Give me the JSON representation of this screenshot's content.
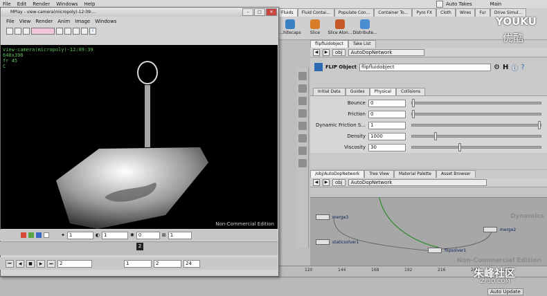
{
  "menubar": [
    "File",
    "Edit",
    "Render",
    "Windows",
    "Help"
  ],
  "topright": {
    "checkbox_label": "Auto Takes",
    "desktop": "Main"
  },
  "shelf": {
    "tabs": [
      "Fluids",
      "Fluid Contai...",
      "Populate Con...",
      "Container To...",
      "Pyro FX",
      "Cloth",
      "Wires",
      "Fur",
      "Drive Simul..."
    ],
    "tools": [
      "...hitecaps",
      "Slice",
      "Slice Alon...",
      "Distribute..."
    ]
  },
  "mplay": {
    "title": "MPlay - view-camera(micropoly)-12:09:...",
    "menu": [
      "File",
      "View",
      "Render",
      "Anim",
      "Image",
      "Windows"
    ],
    "overlay": [
      "view-camera(micropoly)-12:09:39",
      "640x398",
      "fr 45",
      "C"
    ],
    "watermark": "Non-Commercial Edition",
    "ctrl": {
      "f1": "1",
      "f2": "1",
      "f3": "0",
      "f4": "1"
    },
    "frame_marker": "2",
    "play": {
      "frame": "2",
      "start": "1",
      "cur": "2",
      "end": "24"
    }
  },
  "param_panel": {
    "tabs": [
      "flipfluidobject",
      "Take List"
    ],
    "path": [
      "obj",
      "AutoDopNetwork"
    ],
    "type_label": "FLIP Object",
    "name": "flipfluidobject",
    "subtabs": [
      "Initial Data",
      "Guides",
      "Physical",
      "Collisions"
    ],
    "params": [
      {
        "label": "Bounce",
        "value": "0"
      },
      {
        "label": "Friction",
        "value": "0"
      },
      {
        "label": "Dynamic Friction S...",
        "value": "1"
      },
      {
        "label": "Density",
        "value": "1000"
      },
      {
        "label": "Viscosity",
        "value": "30"
      }
    ]
  },
  "network": {
    "tabs": [
      "/obj/AutoDopNetwork",
      "Tree View",
      "Material Palette",
      "Asset Browser"
    ],
    "path": [
      "obj",
      "AutoDopNetwork"
    ],
    "nodes": [
      "merge3",
      "merge2",
      "staticsolver1",
      "flipsolver1"
    ],
    "watermark_top": "Dynamics",
    "watermark_bottom": "Non-Commercial Edition"
  },
  "ruler": [
    "120",
    "144",
    "168",
    "192",
    "216",
    "240",
    "264"
  ],
  "overlay_logos": {
    "youku": "YOUKU",
    "youku_cn": "优酷",
    "zf3d": "ZF3D.COM",
    "zf3d_cn": "朱峰社区"
  },
  "status": {
    "auto_update": "Auto Update"
  }
}
